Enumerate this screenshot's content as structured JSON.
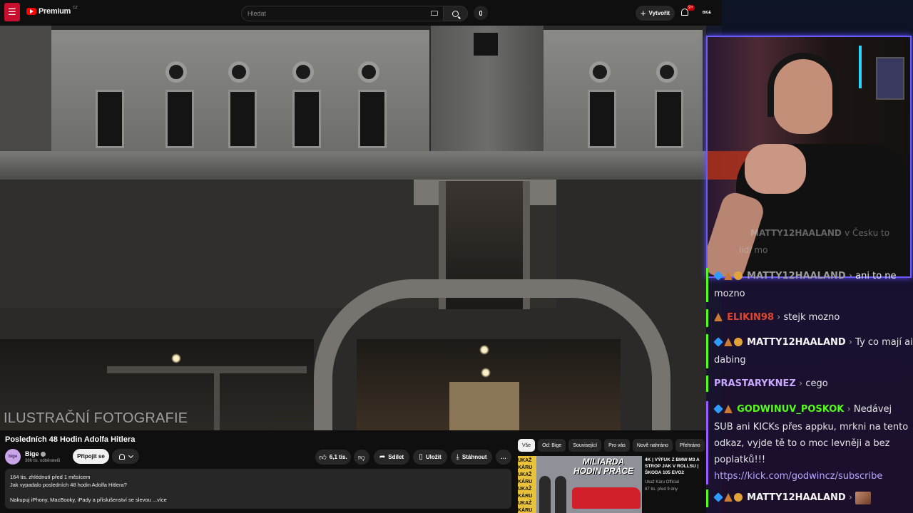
{
  "topbar": {
    "logo_text": "Premium",
    "country_code": "CZ",
    "search_placeholder": "Hledat",
    "create_label": "Vytvořit",
    "notif_count": "9+",
    "avatar_text": "BIGE"
  },
  "video": {
    "overlay_text": "ILUSTRAČNÍ FOTOGRAFIE",
    "title": "Posledních 48 Hodin Adolfa Hitlera",
    "channel_name": "Bige",
    "channel_avatar_text": "bige",
    "subscribers": "386 tis. odběratelů",
    "join_label": "Připojit se",
    "likes": "6,1 tis.",
    "share_label": "Sdílet",
    "save_label": "Uložit",
    "download_label": "Stáhnout",
    "more_label": "…",
    "description": {
      "meta": "164 tis. zhlédnutí  před 1 měsícem",
      "line1": "Jak vypadalo posledních 48 hodin Adolfa Hitlera?",
      "line2": "Nakupuj iPhony, MacBooky, iPady a příslušenství se slevou",
      "more": "...více"
    }
  },
  "chips": [
    "Vše",
    "Od: Bige",
    "Související",
    "Pro vás",
    "Nově nahráno",
    "Přehráno"
  ],
  "related": {
    "thumb_badge": "UKAŽ KÁRU UKAŽ KÁRU UKAŽ KÁRU UKAŽ KÁRU",
    "thumb_title": "MILIARDA HODIN PRÁCE",
    "title": "4K | VÝFUK Z BMW M3 A STROP JAK V ROLLSU | ŠKODA 105 EVO2",
    "channel": "Ukaž Káru Official",
    "meta": "87 tis.   před 9 dny"
  },
  "webcam_overlay_text": {
    "user": "MATTY12HAALAND",
    "text": "v Česku to",
    "text2": "lidi mo"
  },
  "chat": [
    {
      "user": "MATTY12HAALAND",
      "user_color": "#9a9a9a",
      "badges": [
        "blue",
        "bronze",
        "gold"
      ],
      "text": "ani to ne mozno"
    },
    {
      "user": "ELIKIN98",
      "user_color": "#e0462b",
      "badges": [
        "bronze"
      ],
      "text": "stejk mozno"
    },
    {
      "user": "MATTY12HAALAND",
      "user_color": "#f5f5f5",
      "badges": [
        "blue",
        "bronze",
        "gold"
      ],
      "text": "Ty co mají ai dabing"
    },
    {
      "user": "PRASTARYKNEZ",
      "user_color": "#c9a8ff",
      "badges": [],
      "text": "cego"
    },
    {
      "user": "GODWINUV_POSKOK",
      "user_color": "#53fc18",
      "badges": [
        "blue",
        "bronze"
      ],
      "text": "Nedávej SUB ani KICKs přes appku, mrkni na tento odkaz, vyjde tě to o moc levněji a bez poplatků!!!",
      "link": "https://kick.com/godwincz/subscribe"
    },
    {
      "user": "MATTY12HAALAND",
      "user_color": "#f5f5f5",
      "badges": [
        "blue",
        "bronze",
        "gold"
      ],
      "text": ""
    }
  ],
  "colors": {
    "accent_green": "#53fc18",
    "accent_purple": "#9b5cff",
    "youtube_red": "#ff0000"
  }
}
